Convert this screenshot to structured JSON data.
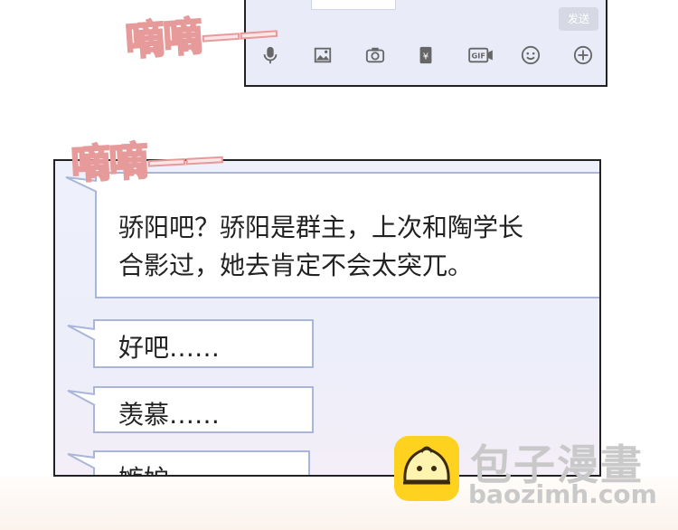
{
  "top_panel": {
    "send_label": "发送",
    "toolbar_icons": [
      "microphone-icon",
      "image-icon",
      "camera-icon",
      "red-envelope-icon",
      "gif-icon",
      "emoji-icon",
      "plus-icon"
    ],
    "gif_label": "GIF",
    "yen_label": "¥"
  },
  "sound_effects": [
    "嘀嘀——",
    "嘀嘀——"
  ],
  "messages": [
    {
      "lines": [
        "骄阳吧？骄阳是群主，上次和陶学长",
        "合影过，她去肯定不会太突兀。"
      ]
    },
    {
      "text": "好吧……"
    },
    {
      "text": "羡慕……"
    },
    {
      "text": "嫉妒……"
    }
  ],
  "watermark": {
    "title": "包子漫畫",
    "url": "baozimh.com"
  }
}
